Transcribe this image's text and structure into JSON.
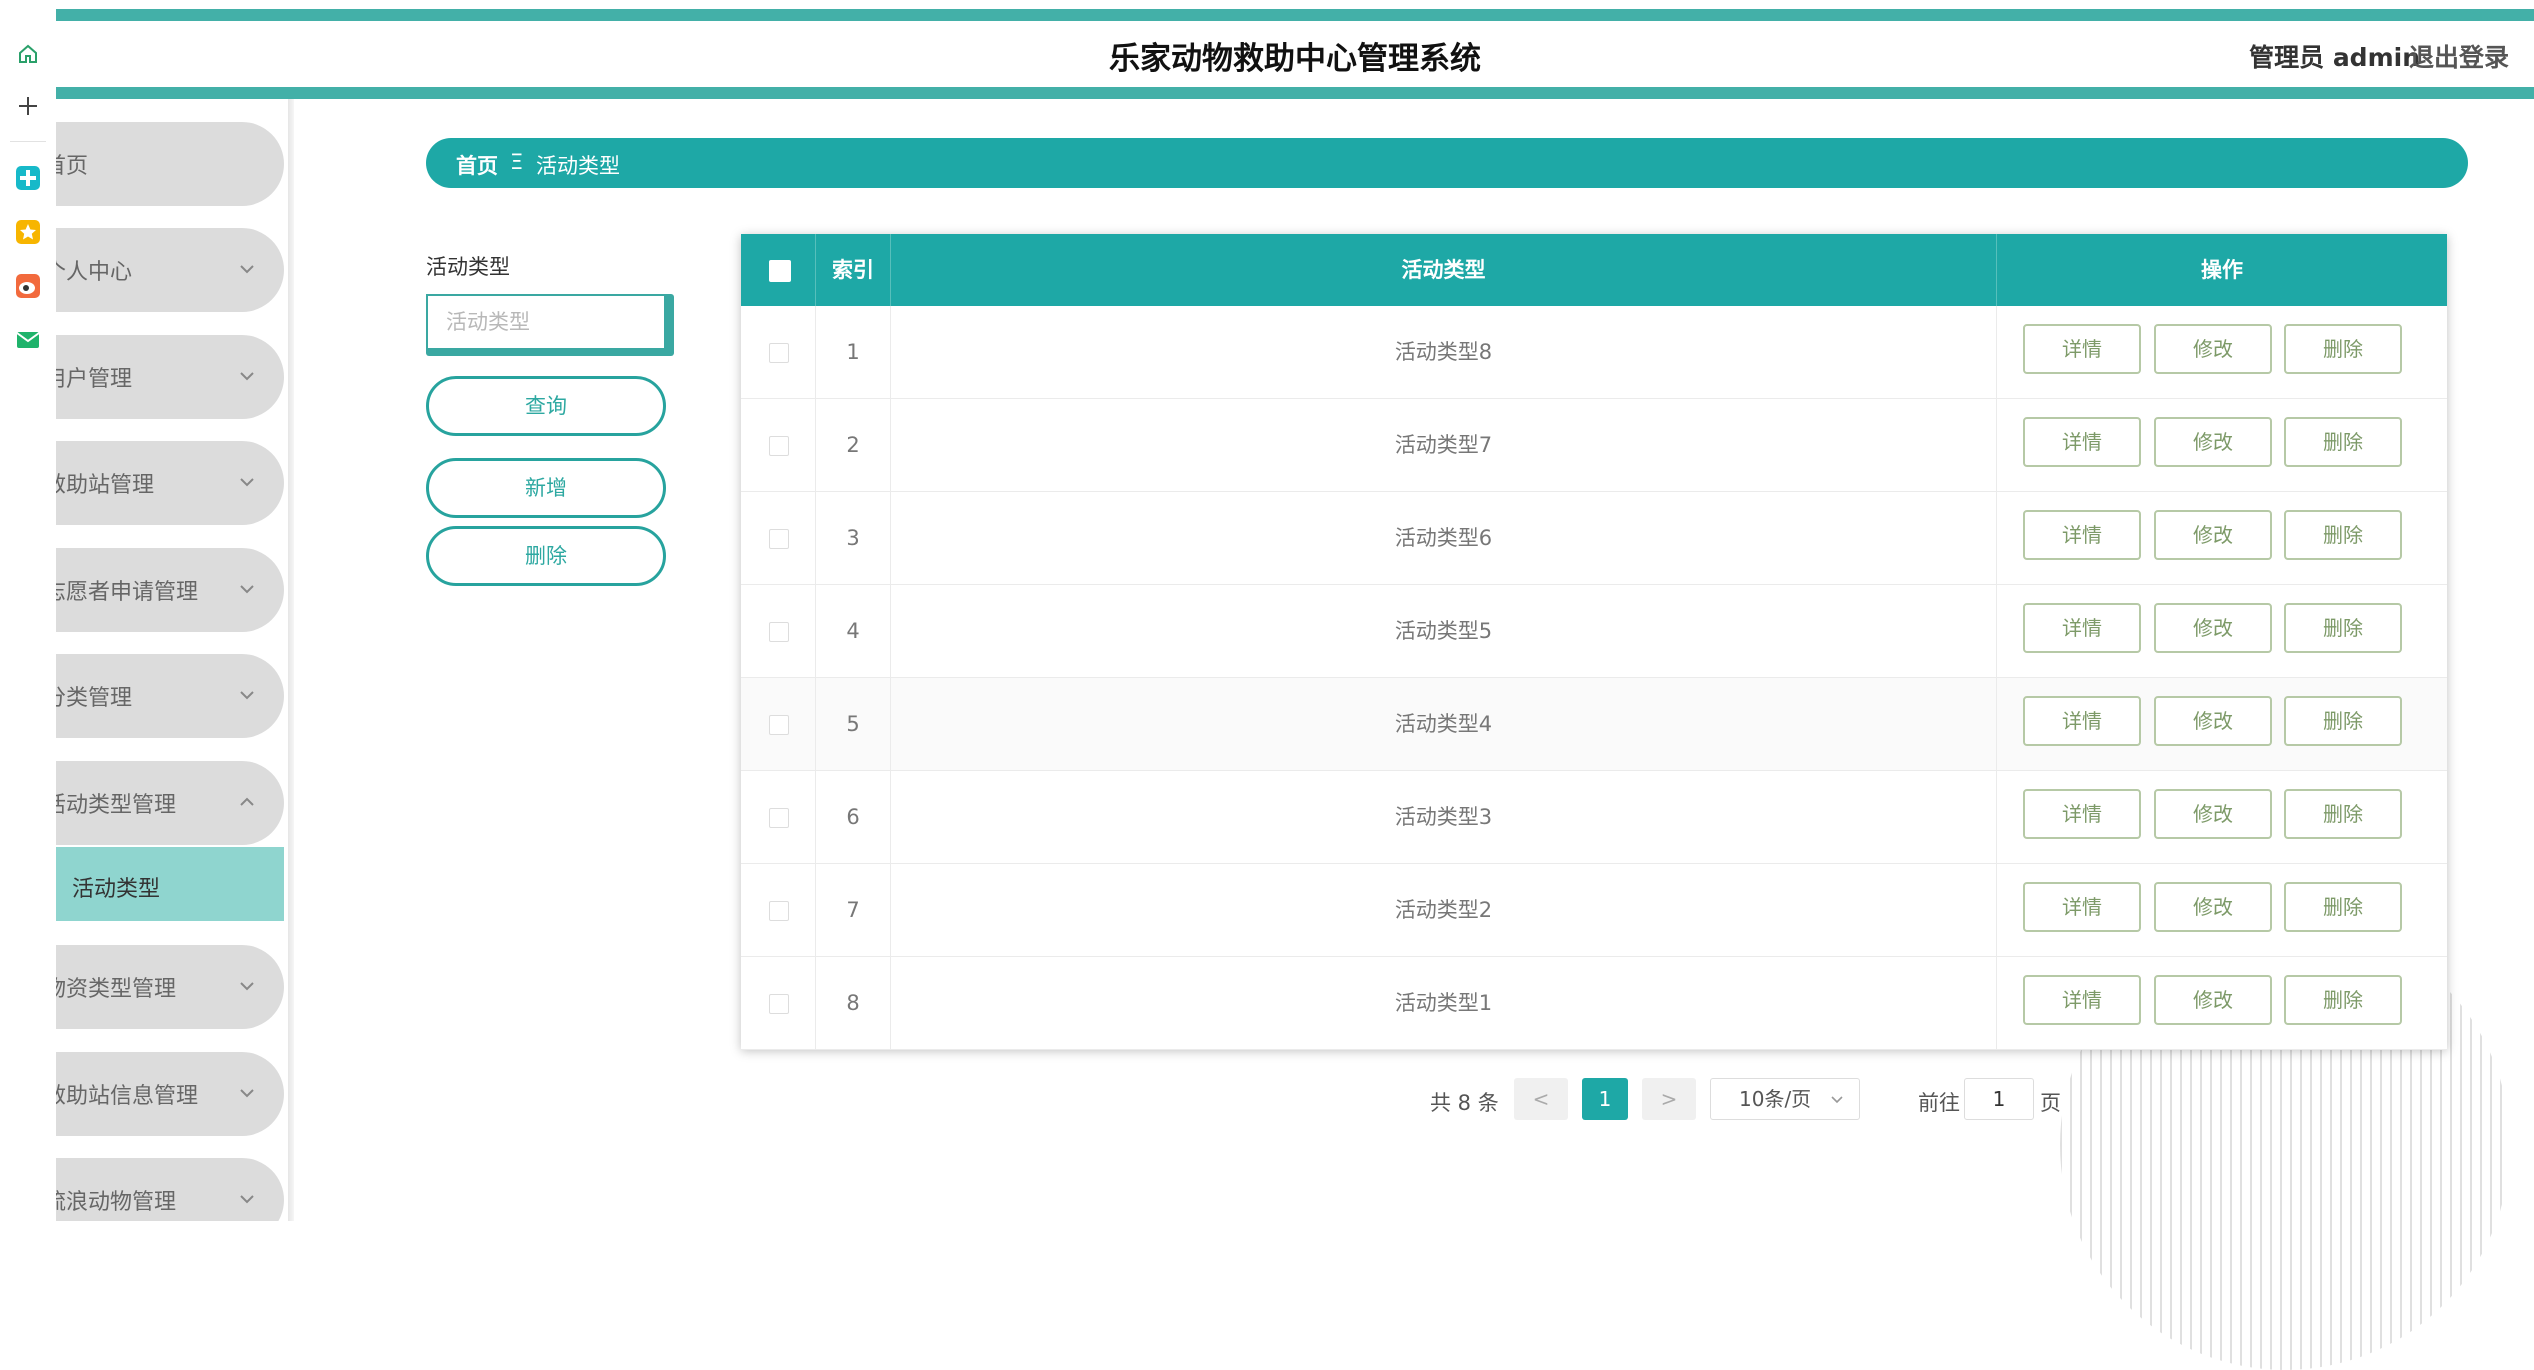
{
  "header": {
    "title": "乐家动物救助中心管理系统",
    "admin": "管理员 admin",
    "logout": "退出登录"
  },
  "sidebar": {
    "items": [
      {
        "label": "首页"
      },
      {
        "label": "个人中心"
      },
      {
        "label": "用户管理"
      },
      {
        "label": "救助站管理"
      },
      {
        "label": "志愿者申请管理"
      },
      {
        "label": "分类管理"
      },
      {
        "label": "活动类型管理"
      },
      {
        "label": "物资类型管理"
      },
      {
        "label": "救助站信息管理"
      },
      {
        "label": "流浪动物管理"
      }
    ],
    "active_sub": "活动类型"
  },
  "breadcrumb": {
    "home": "首页",
    "separator": "Ξ",
    "current": "活动类型"
  },
  "search": {
    "label": "活动类型",
    "placeholder": "活动类型",
    "query_btn": "查询",
    "add_btn": "新增",
    "delete_btn": "删除"
  },
  "table": {
    "columns": [
      "索引",
      "活动类型",
      "操作"
    ],
    "rows": [
      {
        "index": "1",
        "type": "活动类型8"
      },
      {
        "index": "2",
        "type": "活动类型7"
      },
      {
        "index": "3",
        "type": "活动类型6"
      },
      {
        "index": "4",
        "type": "活动类型5"
      },
      {
        "index": "5",
        "type": "活动类型4"
      },
      {
        "index": "6",
        "type": "活动类型3"
      },
      {
        "index": "7",
        "type": "活动类型2"
      },
      {
        "index": "8",
        "type": "活动类型1"
      }
    ],
    "actions": {
      "detail": "详情",
      "edit": "修改",
      "delete": "删除"
    }
  },
  "pagination": {
    "total": "共 8 条",
    "prev": "<",
    "next": ">",
    "current_page": "1",
    "page_size": "10条/页",
    "goto": "前往",
    "goto_value": "1",
    "page_suffix": "页"
  },
  "colors": {
    "accent": "#1ea8a6",
    "header_band": "#43b0a8",
    "active_sub": "#8fd5cf",
    "action_btn": "#7d9a68"
  },
  "icons": [
    "home-icon",
    "plus-icon",
    "puzzle-icon",
    "star-icon",
    "weibo-icon",
    "mail-icon",
    "chevron-down-icon",
    "chevron-up-icon"
  ]
}
